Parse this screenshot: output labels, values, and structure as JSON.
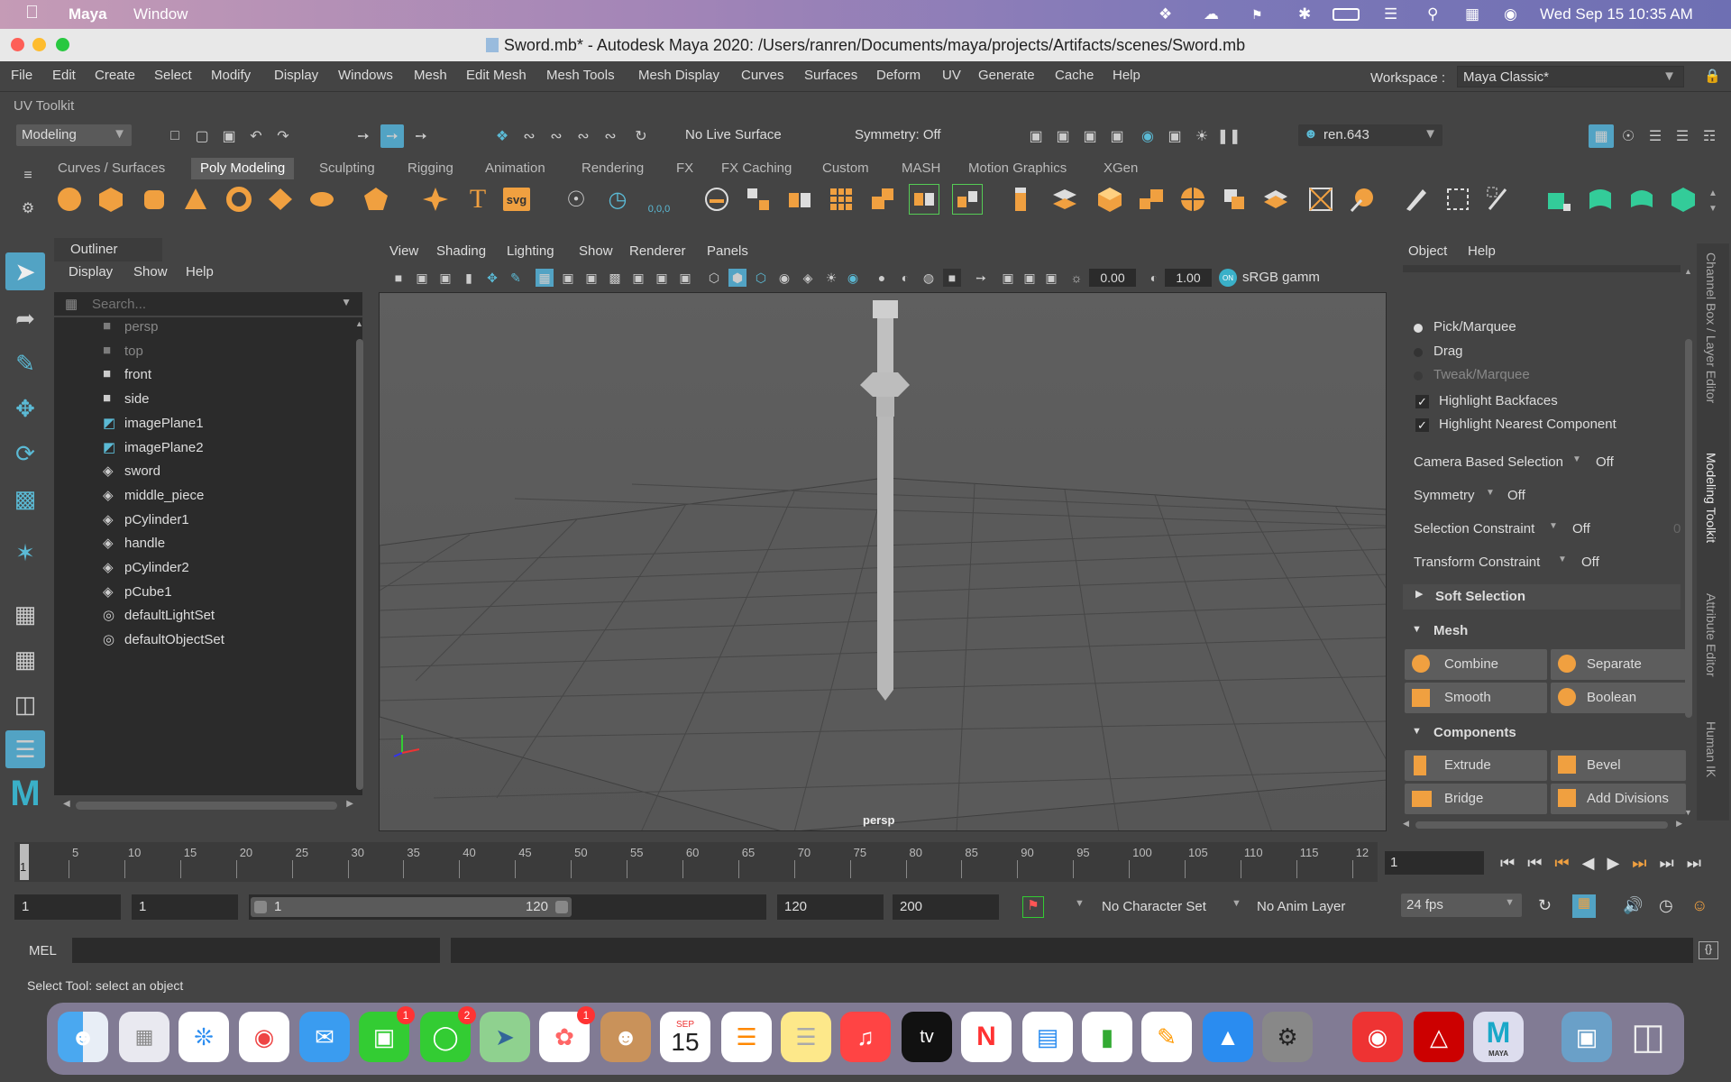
{
  "mac_menubar": {
    "app": "Maya",
    "window": "Window",
    "datetime": "Wed Sep 15  10:35 AM"
  },
  "window": {
    "title": "Sword.mb* - Autodesk Maya 2020: /Users/ranren/Documents/maya/projects/Artifacts/scenes/Sword.mb"
  },
  "menus": [
    "File",
    "Edit",
    "Create",
    "Select",
    "Modify",
    "Display",
    "Windows",
    "Mesh",
    "Edit Mesh",
    "Mesh Tools",
    "Mesh Display",
    "Curves",
    "Surfaces",
    "Deform",
    "UV",
    "Generate",
    "Cache",
    "Help"
  ],
  "workspace": {
    "label": "Workspace :",
    "value": "Maya Classic*"
  },
  "uv_toolkit": "UV Toolkit",
  "status_line": {
    "mode": "Modeling",
    "live_surface": "No Live Surface",
    "symmetry": "Symmetry: Off",
    "user": "ren.643"
  },
  "shelf_tabs": [
    "Curves / Surfaces",
    "Poly Modeling",
    "Sculpting",
    "Rigging",
    "Animation",
    "Rendering",
    "FX",
    "FX Caching",
    "Custom",
    "MASH",
    "Motion Graphics",
    "XGen"
  ],
  "shelf_active": "Poly Modeling",
  "shelf_labels": {
    "text_tool": "T",
    "svg_tool": "svg",
    "snap": "0,0,0"
  },
  "outliner": {
    "title": "Outliner",
    "menu": [
      "Display",
      "Show",
      "Help"
    ],
    "search_placeholder": "Search...",
    "items": [
      {
        "name": "persp",
        "type": "camera",
        "dim": true
      },
      {
        "name": "top",
        "type": "camera",
        "dim": true
      },
      {
        "name": "front",
        "type": "camera",
        "dim": false
      },
      {
        "name": "side",
        "type": "camera",
        "dim": false
      },
      {
        "name": "imagePlane1",
        "type": "imageplane",
        "dim": false
      },
      {
        "name": "imagePlane2",
        "type": "imageplane",
        "dim": false
      },
      {
        "name": "sword",
        "type": "mesh",
        "dim": false
      },
      {
        "name": "middle_piece",
        "type": "mesh",
        "dim": false
      },
      {
        "name": "pCylinder1",
        "type": "mesh",
        "dim": false
      },
      {
        "name": "handle",
        "type": "mesh",
        "dim": false
      },
      {
        "name": "pCylinder2",
        "type": "mesh",
        "dim": false
      },
      {
        "name": "pCube1",
        "type": "mesh",
        "dim": false
      },
      {
        "name": "defaultLightSet",
        "type": "set",
        "dim": false
      },
      {
        "name": "defaultObjectSet",
        "type": "set",
        "dim": false
      }
    ]
  },
  "viewport": {
    "menu": [
      "View",
      "Shading",
      "Lighting",
      "Show",
      "Renderer",
      "Panels"
    ],
    "exposure": "0.00",
    "gamma": "1.00",
    "colorspace": "sRGB gamm",
    "camera_label": "persp",
    "color_mgmt": "ON"
  },
  "modeling_toolkit": {
    "menu": [
      "Object",
      "Help"
    ],
    "pick_options": [
      {
        "label": "Pick/Marquee",
        "selected": true,
        "dim": false
      },
      {
        "label": "Drag",
        "selected": false,
        "dim": false
      },
      {
        "label": "Tweak/Marquee",
        "selected": false,
        "dim": true
      }
    ],
    "checkboxes": [
      {
        "label": "Highlight Backfaces",
        "checked": true
      },
      {
        "label": "Highlight Nearest Component",
        "checked": true
      }
    ],
    "settings": [
      {
        "label": "Camera Based Selection",
        "value": "Off"
      },
      {
        "label": "Symmetry",
        "value": "Off"
      },
      {
        "label": "Selection Constraint",
        "value": "Off",
        "extra": "0"
      },
      {
        "label": "Transform Constraint",
        "value": "Off"
      }
    ],
    "soft_selection": "Soft Selection",
    "mesh_section": "Mesh",
    "mesh_buttons": [
      "Combine",
      "Separate",
      "Smooth",
      "Boolean"
    ],
    "components_section": "Components",
    "component_buttons": [
      "Extrude",
      "Bevel",
      "Bridge",
      "Add Divisions"
    ]
  },
  "side_tabs": [
    "Channel Box / Layer Editor",
    "Modeling Toolkit",
    "Attribute Editor",
    "Human IK"
  ],
  "timeline": {
    "ticks": [
      "5",
      "10",
      "15",
      "20",
      "25",
      "30",
      "35",
      "40",
      "45",
      "50",
      "55",
      "60",
      "65",
      "70",
      "75",
      "80",
      "85",
      "90",
      "95",
      "100",
      "105",
      "110",
      "115",
      "12"
    ],
    "current_marker": "1",
    "current_frame": "1"
  },
  "range": {
    "start": "1",
    "playback_start": "1",
    "slider_start": "1",
    "slider_end": "120",
    "playback_end": "120",
    "end": "200",
    "character_set": "No Character Set",
    "anim_layer": "No Anim Layer",
    "fps": "24 fps"
  },
  "command": {
    "lang": "MEL",
    "help": "Select Tool: select an object"
  },
  "dock": {
    "calendar_month": "SEP",
    "calendar_day": "15",
    "badges": {
      "facetime": "1",
      "messages": "2",
      "photos": "1"
    },
    "appletv": "tv",
    "maya_label": "MAYA"
  },
  "colors": {
    "accent": "#5bbad5",
    "shelf_orange": "#f0a040",
    "selected_blue": "#52a3c4"
  }
}
